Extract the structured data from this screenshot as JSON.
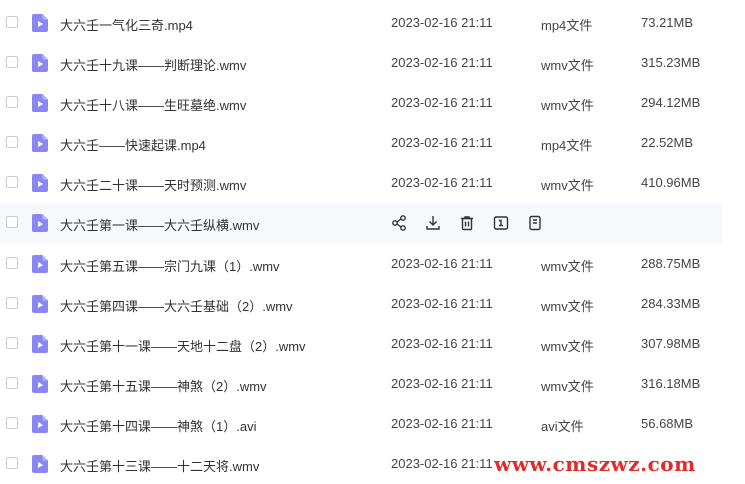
{
  "files": [
    {
      "name": "大六壬一气化三奇.mp4",
      "date": "2023-02-16 21:11",
      "type": "mp4文件",
      "size": "73.21MB"
    },
    {
      "name": "大六壬十九课——判断理论.wmv",
      "date": "2023-02-16 21:11",
      "type": "wmv文件",
      "size": "315.23MB"
    },
    {
      "name": "大六壬十八课——生旺墓绝.wmv",
      "date": "2023-02-16 21:11",
      "type": "wmv文件",
      "size": "294.12MB"
    },
    {
      "name": "大六壬——快速起课.mp4",
      "date": "2023-02-16 21:11",
      "type": "mp4文件",
      "size": "22.52MB"
    },
    {
      "name": "大六壬二十课——天时预测.wmv",
      "date": "2023-02-16 21:11",
      "type": "wmv文件",
      "size": "410.96MB"
    },
    {
      "name": "大六壬第一课——大六壬纵横.wmv",
      "date": "",
      "type": "",
      "size": "",
      "hover": true
    },
    {
      "name": "大六壬第五课——宗门九课（1）.wmv",
      "date": "2023-02-16 21:11",
      "type": "wmv文件",
      "size": "288.75MB"
    },
    {
      "name": "大六壬第四课——大六壬基础（2）.wmv",
      "date": "2023-02-16 21:11",
      "type": "wmv文件",
      "size": "284.33MB"
    },
    {
      "name": "大六壬第十一课——天地十二盘（2）.wmv",
      "date": "2023-02-16 21:11",
      "type": "wmv文件",
      "size": "307.98MB"
    },
    {
      "name": "大六壬第十五课——神煞（2）.wmv",
      "date": "2023-02-16 21:11",
      "type": "wmv文件",
      "size": "316.18MB"
    },
    {
      "name": "大六壬第十四课——神煞（1）.avi",
      "date": "2023-02-16 21:11",
      "type": "avi文件",
      "size": "56.68MB"
    },
    {
      "name": "大六壬第十三课——十二天将.wmv",
      "date": "2023-02-16 21:11",
      "type": "",
      "size": ""
    }
  ],
  "hover_actions": [
    "share-icon",
    "download-icon",
    "delete-icon",
    "rename-icon",
    "copy-icon"
  ],
  "watermark": "www.cmszwz.com",
  "colors": {
    "file_icon": "#8a87f3",
    "hover_bg": "#f7f8fb",
    "watermark": "#e02b2b"
  }
}
